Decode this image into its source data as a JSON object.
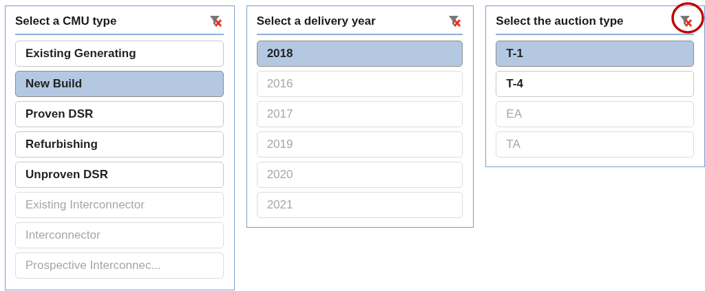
{
  "slicers": [
    {
      "title": "Select a CMU type",
      "clear_circled": false,
      "items": [
        {
          "label": "Existing Generating",
          "selected": false,
          "disabled": false
        },
        {
          "label": "New Build",
          "selected": true,
          "disabled": false
        },
        {
          "label": "Proven DSR",
          "selected": false,
          "disabled": false
        },
        {
          "label": "Refurbishing",
          "selected": false,
          "disabled": false
        },
        {
          "label": "Unproven DSR",
          "selected": false,
          "disabled": false
        },
        {
          "label": "Existing Interconnector",
          "selected": false,
          "disabled": true
        },
        {
          "label": "Interconnector",
          "selected": false,
          "disabled": true
        },
        {
          "label": "Prospective Interconnec...",
          "selected": false,
          "disabled": true
        }
      ]
    },
    {
      "title": "Select a delivery year",
      "clear_circled": false,
      "items": [
        {
          "label": "2018",
          "selected": true,
          "disabled": false
        },
        {
          "label": "2016",
          "selected": false,
          "disabled": true
        },
        {
          "label": "2017",
          "selected": false,
          "disabled": true
        },
        {
          "label": "2019",
          "selected": false,
          "disabled": true
        },
        {
          "label": "2020",
          "selected": false,
          "disabled": true
        },
        {
          "label": "2021",
          "selected": false,
          "disabled": true
        }
      ]
    },
    {
      "title": "Select the auction type",
      "clear_circled": true,
      "items": [
        {
          "label": "T-1",
          "selected": true,
          "disabled": false
        },
        {
          "label": "T-4",
          "selected": false,
          "disabled": false
        },
        {
          "label": "EA",
          "selected": false,
          "disabled": true
        },
        {
          "label": "TA",
          "selected": false,
          "disabled": true
        }
      ]
    }
  ]
}
